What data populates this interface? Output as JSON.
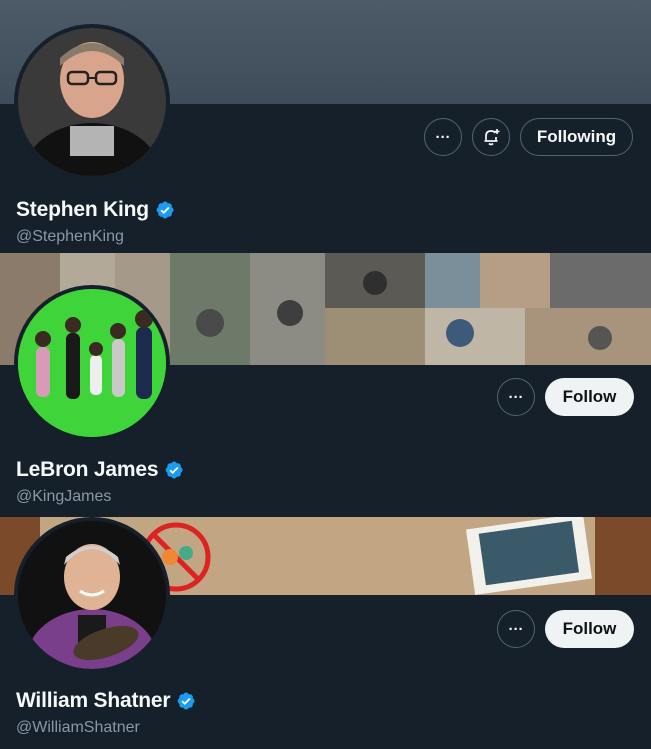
{
  "profiles": [
    {
      "name": "Stephen King",
      "handle": "@StephenKing",
      "verified": true,
      "actions": {
        "more_label": "···",
        "notify_icon": "bell-plus-icon",
        "follow_label": "Following"
      }
    },
    {
      "name": "LeBron James",
      "handle": "@KingJames",
      "verified": true,
      "actions": {
        "more_label": "···",
        "follow_label": "Follow"
      }
    },
    {
      "name": "William Shatner",
      "handle": "@WilliamShatner",
      "verified": true,
      "actions": {
        "more_label": "···",
        "follow_label": "Follow"
      }
    }
  ],
  "colors": {
    "background": "#15202b",
    "banner_slate": "#4a5866",
    "verified_blue": "#1d9bf0",
    "muted_text": "#8b98a5",
    "follow_button_bg": "#eff3f4"
  }
}
